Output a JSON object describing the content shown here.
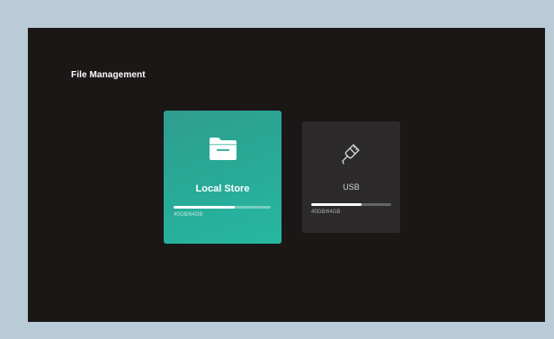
{
  "page_title": "File Management",
  "cards": [
    {
      "label": "Local Store",
      "icon": "folder-icon",
      "usage_text": "40GB/64GB",
      "usage_fraction": 0.625,
      "state": "selected",
      "color": "#2aa996"
    },
    {
      "label": "USB",
      "icon": "usb-plug-icon",
      "usage_text": "40GB/64GB",
      "usage_fraction": 0.625,
      "state": "default",
      "color": "#2c2a2a"
    }
  ]
}
